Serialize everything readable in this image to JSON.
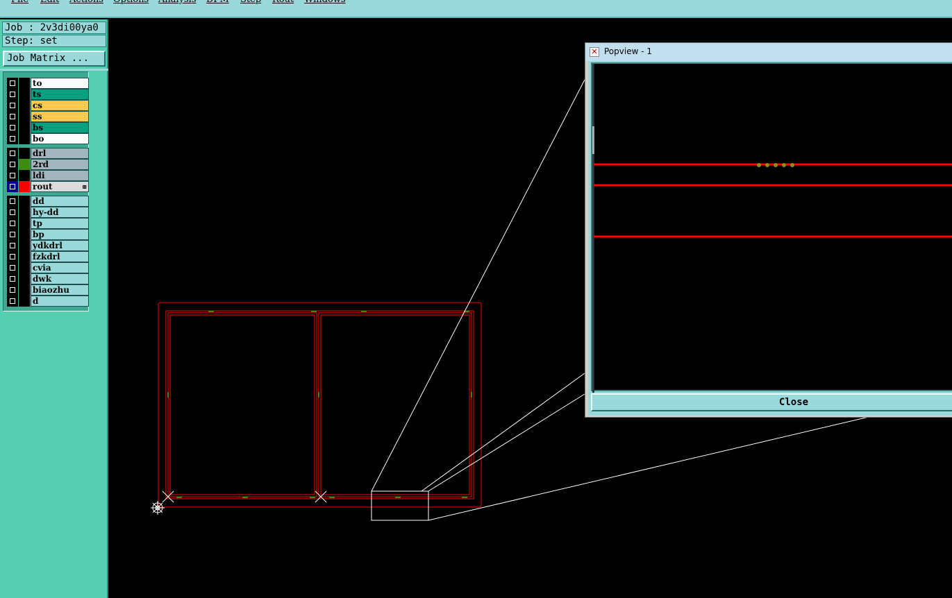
{
  "menubar": {
    "items": [
      "File",
      "Edit",
      "Actions",
      "Options",
      "Analysis",
      "DFM",
      "Step",
      "Rout",
      "Windows"
    ]
  },
  "job": {
    "label": "Job : 2v3di00ya0"
  },
  "step": {
    "label": "Step: set"
  },
  "job_matrix": {
    "label": "Job Matrix ..."
  },
  "layers": [
    {
      "name": "to",
      "bg": "#ffffff",
      "swatch": "#000000",
      "active": false
    },
    {
      "name": "ts",
      "bg": "#00a080",
      "swatch": "#000000",
      "active": false
    },
    {
      "name": "cs",
      "bg": "#ffc850",
      "swatch": "#000000",
      "active": false
    },
    {
      "name": "ss",
      "bg": "#ffc850",
      "swatch": "#000000",
      "active": false
    },
    {
      "name": "bs",
      "bg": "#00a080",
      "swatch": "#000000",
      "active": false
    },
    {
      "name": "bo",
      "bg": "#ffffff",
      "swatch": "#000000",
      "active": false
    },
    {
      "name": "drl",
      "bg": "#a4b4bc",
      "swatch": "#000000",
      "active": false
    },
    {
      "name": "2rd",
      "bg": "#a4b4bc",
      "swatch": "#3c8c14",
      "active": false
    },
    {
      "name": "ldi",
      "bg": "#a4b4bc",
      "swatch": "#000000",
      "active": false
    },
    {
      "name": "rout",
      "bg": "#dcdcdc",
      "swatch": "#ff0000",
      "active": true,
      "mark": "⊞"
    },
    {
      "name": "dd",
      "bg": "#9ad9d9",
      "swatch": "#000000",
      "active": false
    },
    {
      "name": "hy-dd",
      "bg": "#9ad9d9",
      "swatch": "#000000",
      "active": false
    },
    {
      "name": "tp",
      "bg": "#9ad9d9",
      "swatch": "#000000",
      "active": false
    },
    {
      "name": "bp",
      "bg": "#9ad9d9",
      "swatch": "#000000",
      "active": false
    },
    {
      "name": "ydkdrl",
      "bg": "#9ad9d9",
      "swatch": "#000000",
      "active": false
    },
    {
      "name": "fzkdrl",
      "bg": "#9ad9d9",
      "swatch": "#000000",
      "active": false
    },
    {
      "name": "cvia",
      "bg": "#9ad9d9",
      "swatch": "#000000",
      "active": false
    },
    {
      "name": "dwk",
      "bg": "#9ad9d9",
      "swatch": "#000000",
      "active": false
    },
    {
      "name": "biaozhu",
      "bg": "#9ad9d9",
      "swatch": "#000000",
      "active": false
    },
    {
      "name": "d",
      "bg": "#9ad9d9",
      "swatch": "#000000",
      "active": false
    }
  ],
  "popview": {
    "title": "Popview - 1",
    "close_label": "Close"
  },
  "colors": {
    "rout_line": "#ff0000",
    "tab_mark": "#3c8c14",
    "highlight": "#ffffff"
  }
}
